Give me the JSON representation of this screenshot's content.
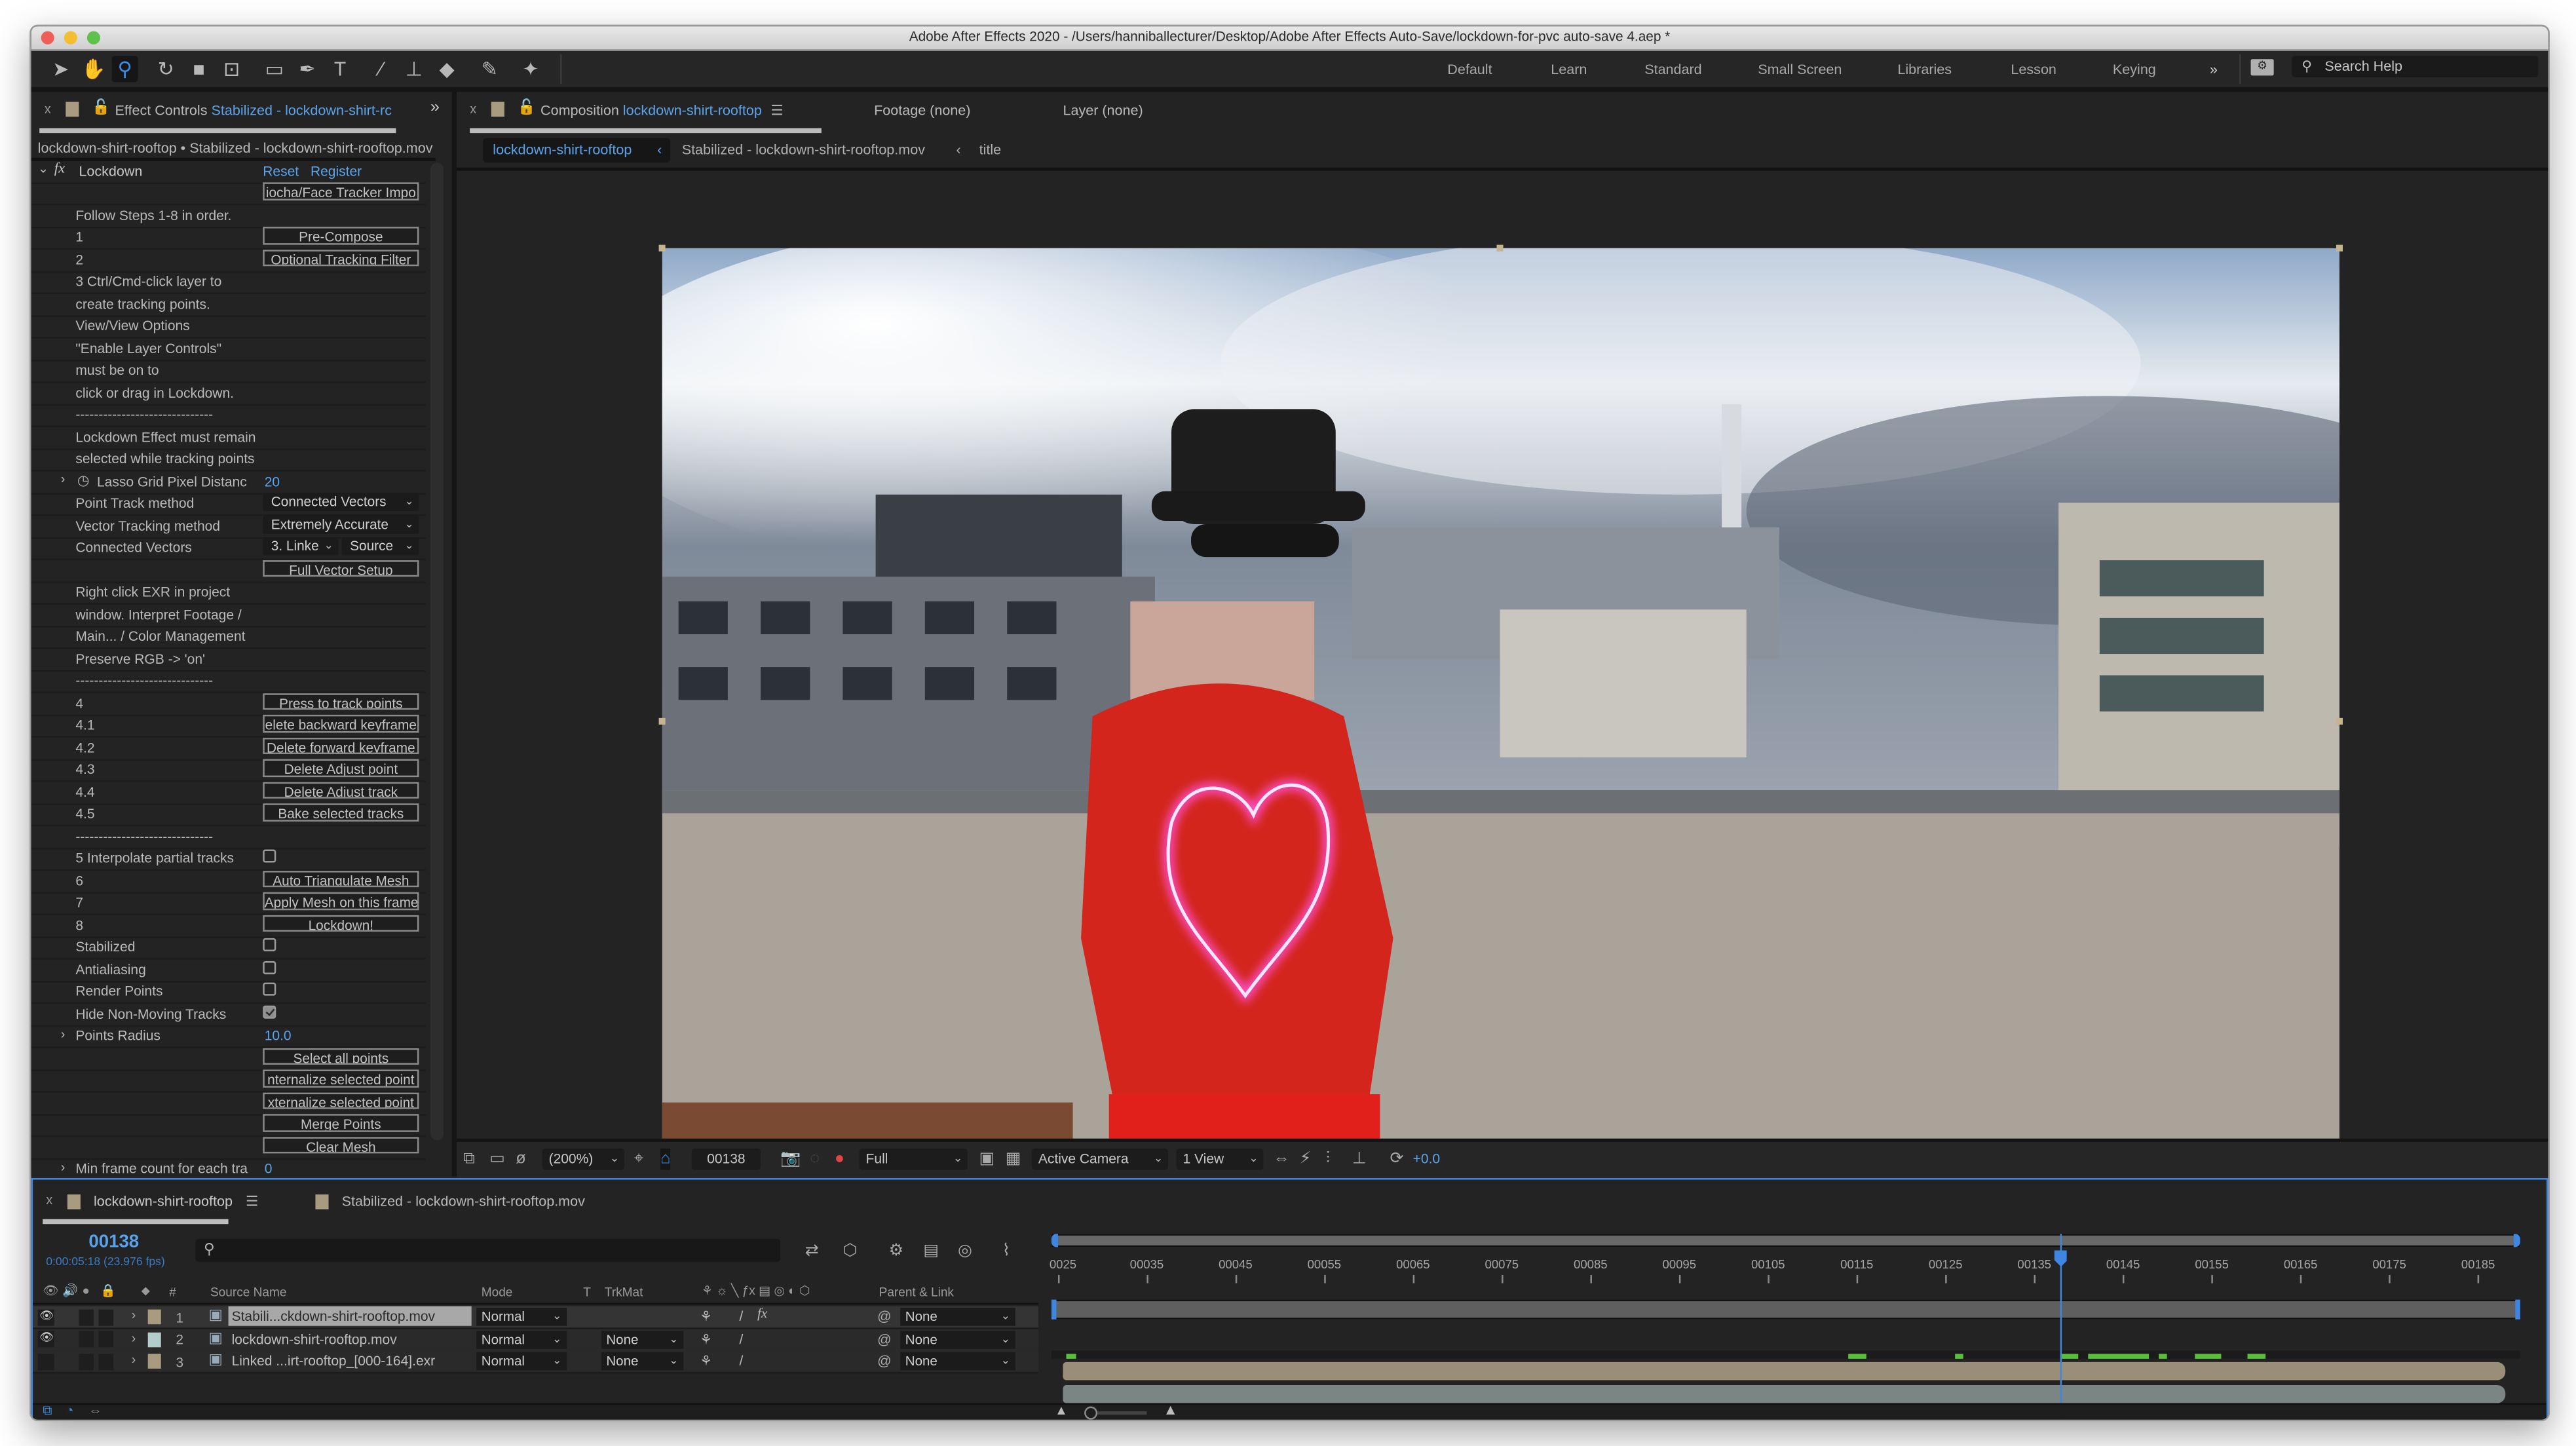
{
  "window": {
    "title": "Adobe After Effects 2020 - /Users/hanniballecturer/Desktop/Adobe After Effects Auto-Save/lockdown-for-pvc auto-save 4.aep *",
    "traffic_lights": {
      "close": "#ee5f57",
      "minimize": "#f5bd31",
      "zoom": "#5ec14b"
    }
  },
  "toolbar": {
    "tools": [
      "selection-tool",
      "hand-tool",
      "zoom-tool",
      "rotation-tool",
      "camera-tool",
      "pan-behind-tool",
      "rectangle-tool",
      "pen-tool",
      "type-tool",
      "brush-tool",
      "clone-stamp-tool",
      "eraser-tool",
      "roto-brush-tool",
      "puppet-pin-tool"
    ],
    "active_tool": "zoom-tool",
    "workspaces": [
      "Default",
      "Learn",
      "Standard",
      "Small Screen",
      "Libraries",
      "Lesson",
      "Keying"
    ],
    "overflow": "»",
    "search_placeholder": "Search Help"
  },
  "effect_controls": {
    "tab_prefix": "Effect Controls",
    "tab_layer": "Stabilized - lockdown-shirt-rc",
    "subtitle": "lockdown-shirt-rooftop • Stabilized - lockdown-shirt-rooftop.mov",
    "effect_name": "Lockdown",
    "reset": "Reset",
    "register": "Register",
    "rows": [
      {
        "type": "button",
        "label": "",
        "button": "iocha/Face Tracker Impo"
      },
      {
        "type": "text",
        "label": "Follow Steps 1-8 in order."
      },
      {
        "type": "button",
        "label": "1",
        "button": "Pre-Compose"
      },
      {
        "type": "button",
        "label": "2",
        "button": "Optional Tracking Filter"
      },
      {
        "type": "text",
        "label": "3 Ctrl/Cmd-click layer to"
      },
      {
        "type": "text",
        "label": "create tracking points."
      },
      {
        "type": "text",
        "label": "View/View Options"
      },
      {
        "type": "text",
        "label": "\"Enable Layer Controls\""
      },
      {
        "type": "text",
        "label": "must be on to"
      },
      {
        "type": "text",
        "label": "click or drag in Lockdown."
      },
      {
        "type": "text",
        "label": "------------------------------"
      },
      {
        "type": "text",
        "label": "Lockdown Effect must remain"
      },
      {
        "type": "text",
        "label": "selected while tracking points"
      },
      {
        "type": "value",
        "label": "Lasso Grid Pixel Distanc",
        "value": "20",
        "twirl": true,
        "stopwatch": true
      },
      {
        "type": "dropdown",
        "label": "Point Track method",
        "value": "Connected Vectors"
      },
      {
        "type": "dropdown",
        "label": "Vector Tracking method",
        "value": "Extremely Accurate"
      },
      {
        "type": "dropdown2",
        "label": "Connected Vectors",
        "value": "3. Linke",
        "value2": "Source"
      },
      {
        "type": "button",
        "label": "",
        "button": "Full Vector Setup"
      },
      {
        "type": "text",
        "label": "Right click EXR in project"
      },
      {
        "type": "text",
        "label": "window. Interpret Footage /"
      },
      {
        "type": "text",
        "label": "Main... / Color Management"
      },
      {
        "type": "text",
        "label": "Preserve RGB -> 'on'"
      },
      {
        "type": "text",
        "label": "------------------------------"
      },
      {
        "type": "button",
        "label": "4",
        "button": "Press to track points"
      },
      {
        "type": "button",
        "label": "4.1",
        "button": "elete backward keyframe"
      },
      {
        "type": "button",
        "label": "4.2",
        "button": "Delete forward keyframe"
      },
      {
        "type": "button",
        "label": "4.3",
        "button": "Delete Adjust point"
      },
      {
        "type": "button",
        "label": "4.4",
        "button": "Delete Adjust track"
      },
      {
        "type": "button",
        "label": "4.5",
        "button": "Bake selected tracks"
      },
      {
        "type": "text",
        "label": "------------------------------"
      },
      {
        "type": "checkbox",
        "label": "5 Interpolate partial tracks",
        "checked": false
      },
      {
        "type": "button",
        "label": "6",
        "button": "Auto Triangulate Mesh"
      },
      {
        "type": "button",
        "label": "7",
        "button": "Apply Mesh on this frame"
      },
      {
        "type": "button",
        "label": "8",
        "button": "Lockdown!"
      },
      {
        "type": "checkbox",
        "label": "Stabilized",
        "checked": false
      },
      {
        "type": "checkbox",
        "label": "Antialiasing",
        "checked": false
      },
      {
        "type": "checkbox",
        "label": "Render Points",
        "checked": false
      },
      {
        "type": "checkbox",
        "label": "Hide Non-Moving Tracks",
        "checked": true
      },
      {
        "type": "value",
        "label": "Points Radius",
        "value": "10.0",
        "twirl": true
      },
      {
        "type": "button",
        "label": "",
        "button": "Select all points"
      },
      {
        "type": "button",
        "label": "",
        "button": "nternalize selected point"
      },
      {
        "type": "button",
        "label": "",
        "button": "xternalize selected point"
      },
      {
        "type": "button",
        "label": "",
        "button": "Merge Points"
      },
      {
        "type": "button",
        "label": "",
        "button": "Clear Mesh"
      },
      {
        "type": "value",
        "label": "Min frame count for each tra",
        "value": "0",
        "twirl": true
      }
    ]
  },
  "composition": {
    "tab_prefix": "Composition",
    "tab_name": "lockdown-shirt-rooftop",
    "footage_tab": "Footage (none)",
    "layer_tab": "Layer (none)",
    "breadcrumb": [
      "lockdown-shirt-rooftop",
      "Stabilized - lockdown-shirt-rooftop.mov",
      "title"
    ],
    "viewer_bar": {
      "magnification": "(200%)",
      "current_frame": "00138",
      "resolution": "Full",
      "camera": "Active Camera",
      "views": "1 View",
      "exposure": "+0.0"
    }
  },
  "timeline": {
    "tab_active": "lockdown-shirt-rooftop",
    "tab_other": "Stabilized - lockdown-shirt-rooftop.mov",
    "current_frame": "00138",
    "timecode": "0:00:05:18 (23.976 fps)",
    "columns": {
      "number": "#",
      "source": "Source Name",
      "mode": "Mode",
      "t": "T",
      "trkmat": "TrkMat",
      "parent": "Parent & Link"
    },
    "layers": [
      {
        "num": "1",
        "name": "Stabili...ckdown-shirt-rooftop.mov",
        "mode": "Normal",
        "trkmat": "",
        "parent": "None",
        "label_color": "#a99b80",
        "visible": true,
        "fx": true,
        "selected": true
      },
      {
        "num": "2",
        "name": "lockdown-shirt-rooftop.mov",
        "mode": "Normal",
        "trkmat": "None",
        "parent": "None",
        "label_color": "#b4cccb",
        "visible": true,
        "fx": false,
        "selected": false
      },
      {
        "num": "3",
        "name": "Linked ...irt-rooftop_[000-164].exr",
        "mode": "Normal",
        "trkmat": "None",
        "parent": "None",
        "label_color": "#a99b80",
        "visible": false,
        "fx": false,
        "selected": false
      }
    ],
    "ruler": {
      "start_label": "0025",
      "labels": [
        "00035",
        "00045",
        "00055",
        "00065",
        "00075",
        "00085",
        "00095",
        "00105",
        "00115",
        "00125",
        "00135",
        "00145",
        "00155",
        "00165",
        "00175",
        "00185"
      ],
      "playhead_frame": 138
    },
    "cached_ranges": [
      [
        26,
        27
      ],
      [
        114,
        116
      ],
      [
        126,
        127
      ],
      [
        138,
        140
      ],
      [
        141,
        148
      ],
      [
        149,
        150
      ],
      [
        153,
        156
      ],
      [
        159,
        161
      ]
    ],
    "bar_colors": [
      "#9b8e78",
      "#7a8584",
      "#6f6758"
    ]
  }
}
